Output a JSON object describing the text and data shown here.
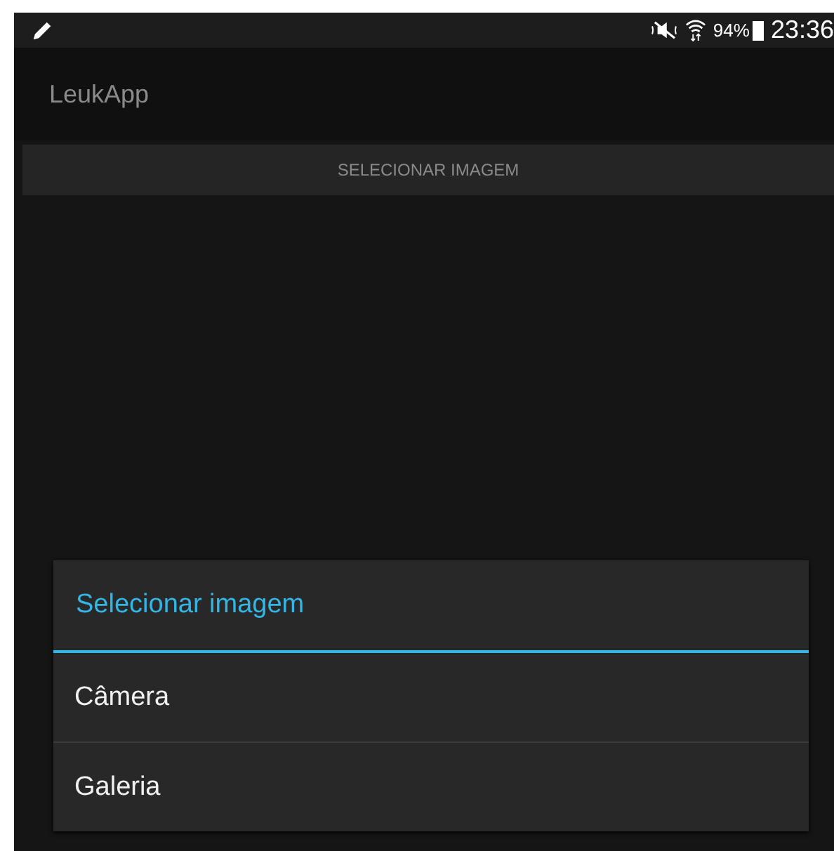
{
  "status_bar": {
    "battery": "94%",
    "time": "23:36"
  },
  "action_bar": {
    "title": "LeukApp"
  },
  "buttons": [
    "SELECIONAR IMAGEM"
  ],
  "dialog": {
    "title": "Selecionar imagem",
    "items": [
      "Câmera",
      "Galeria"
    ]
  }
}
